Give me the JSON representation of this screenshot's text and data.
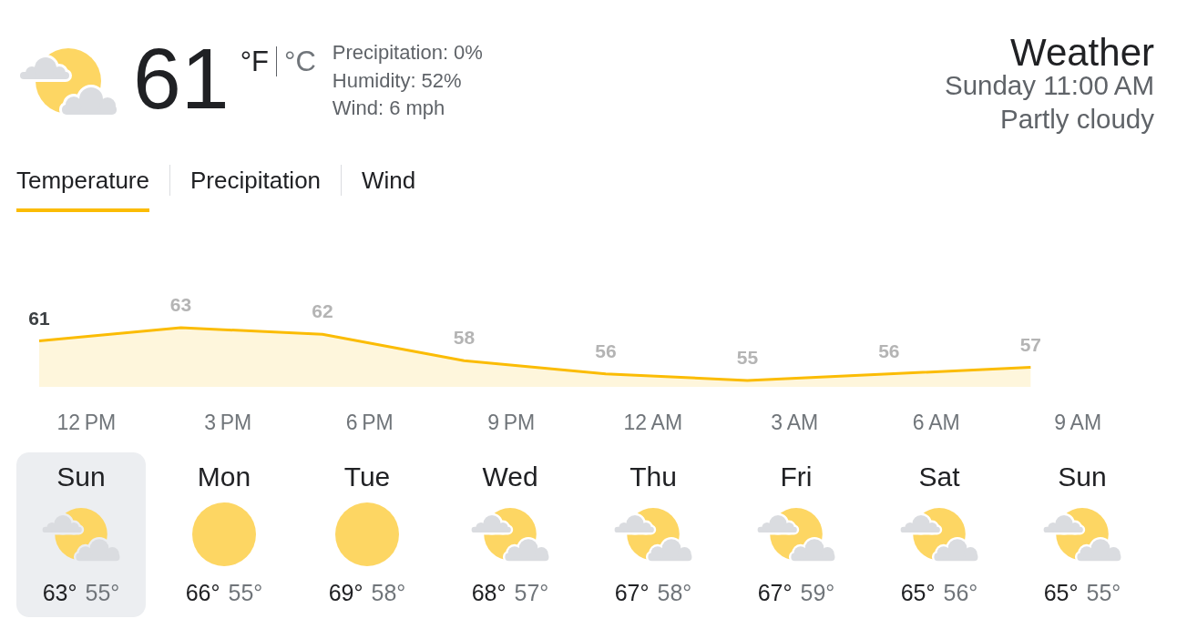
{
  "current": {
    "kind": "partly-cloudy",
    "temperature": "61",
    "units": [
      {
        "label": "°F",
        "selected": true
      },
      {
        "label": "°C",
        "selected": false
      }
    ],
    "details": [
      "Precipitation: 0%",
      "Humidity: 52%",
      "Wind: 6 mph"
    ]
  },
  "header": {
    "title": "Weather",
    "date_time": "Sunday 11:00 AM",
    "condition": "Partly cloudy"
  },
  "tabs": [
    {
      "label": "Temperature",
      "selected": true
    },
    {
      "label": "Precipitation",
      "selected": false
    },
    {
      "label": "Wind",
      "selected": false
    }
  ],
  "chart": {
    "chart_data": {
      "type": "area",
      "categories": [
        null,
        "12 PM",
        null,
        null,
        "3 PM",
        null,
        null,
        "6 PM",
        null,
        null,
        "9 PM",
        null,
        null,
        "12 AM",
        null,
        null,
        "3 AM",
        null,
        null,
        "6 AM",
        null,
        null,
        "9 AM",
        null
      ],
      "series": [
        {
          "color": "#fbbc04",
          "values": [
            61,
            null,
            null,
            63,
            null,
            null,
            62,
            null,
            null,
            58,
            null,
            null,
            56,
            null,
            null,
            55,
            null,
            null,
            56,
            null,
            null,
            57,
            null,
            null
          ]
        }
      ],
      "data_labels": true
    },
    "value_label_states": [
      {
        "selected": true
      },
      {
        "selected": false
      },
      {
        "selected": false
      },
      {
        "selected": false
      },
      {
        "selected": false
      },
      {
        "selected": false
      },
      {
        "selected": false
      },
      {
        "selected": false
      }
    ]
  },
  "days": [
    {
      "name": "Sun",
      "kind": "partly-cloudy",
      "high": "63°",
      "low": "55°",
      "selected": true
    },
    {
      "name": "Mon",
      "kind": "sunny",
      "high": "66°",
      "low": "55°",
      "selected": false
    },
    {
      "name": "Tue",
      "kind": "sunny",
      "high": "69°",
      "low": "58°",
      "selected": false
    },
    {
      "name": "Wed",
      "kind": "partly-cloudy",
      "high": "68°",
      "low": "57°",
      "selected": false
    },
    {
      "name": "Thu",
      "kind": "partly-cloudy",
      "high": "67°",
      "low": "58°",
      "selected": false
    },
    {
      "name": "Fri",
      "kind": "partly-cloudy",
      "high": "67°",
      "low": "59°",
      "selected": false
    },
    {
      "name": "Sat",
      "kind": "partly-cloudy",
      "high": "65°",
      "low": "56°",
      "selected": false
    },
    {
      "name": "Sun",
      "kind": "partly-cloudy",
      "high": "65°",
      "low": "55°",
      "selected": false
    }
  ]
}
